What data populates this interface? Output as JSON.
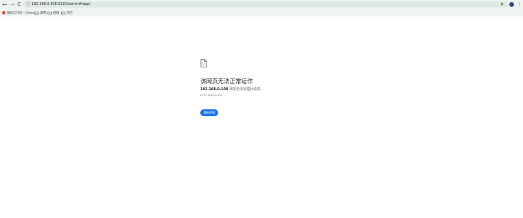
{
  "toolbar": {
    "back_icon": "arrow-left-icon",
    "back_glyph": "←",
    "forward_icon": "arrow-right-icon",
    "forward_glyph": "→",
    "reload_icon": "reload-icon",
    "reload_glyph": "C",
    "site_info_icon": "info-circle-icon",
    "site_info_glyph": "ⓘ",
    "url": "192.168.0.108:3130/admin#/app/",
    "bookmark_star_icon": "star-icon",
    "bookmark_star_glyph": "★",
    "profile_avatar": "avatar",
    "menu_icon": "more-vert-icon",
    "menu_glyph": "⋮"
  },
  "bookmarks": [
    {
      "label": "我的工作台 - Gitee...",
      "icon": "favicon"
    },
    {
      "label": "常用",
      "icon": "folder-icon"
    },
    {
      "label": "前端",
      "icon": "folder-icon"
    },
    {
      "label": "其它",
      "icon": "folder-icon"
    }
  ],
  "error": {
    "icon": "sad-page-icon",
    "title": "该网页无法正常运作",
    "host": "192.168.0.108",
    "message": " 目前无法处理此请求。",
    "code": "HTTP ERROR 500",
    "reload_label": "重新加载"
  },
  "colors": {
    "chrome_bg": "#eef4f1",
    "omnibox_bg": "#dfe8e4",
    "button_blue": "#1a73e8",
    "avatar": "#3b4a8c"
  }
}
